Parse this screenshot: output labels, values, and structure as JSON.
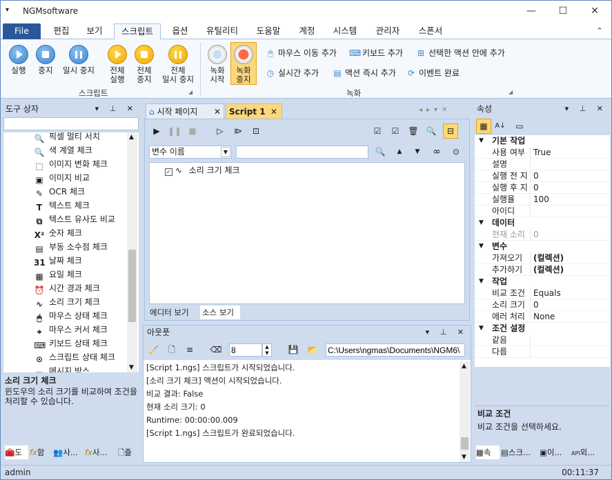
{
  "app": {
    "title": "NGMsoftware",
    "sys_icon": "▾",
    "minimize": "—",
    "maximize": "☐",
    "close": "✕"
  },
  "menu": {
    "file": "File",
    "tabs": [
      "편집",
      "보기",
      "스크립트",
      "옵션",
      "유틸리티",
      "도움말",
      "계정",
      "시스템",
      "관리자",
      "스폰서"
    ],
    "collapse_icon": "chevron-up-icon",
    "collapse": "⌃"
  },
  "ribbon": {
    "script_group": {
      "label": "스크립트",
      "run": "실행",
      "stop": "중지",
      "pause": "일시 중지",
      "run_all": [
        "전체",
        "실행"
      ],
      "stop_all": [
        "전체",
        "중지"
      ],
      "pause_all": [
        "전체",
        "일시 중지"
      ]
    },
    "record_group": {
      "label": "녹화",
      "rec_start": [
        "녹화",
        "시작"
      ],
      "rec_stop": [
        "녹화",
        "중지"
      ],
      "actions": [
        "마우스 이동 추가",
        "키보드 추가",
        "선택한 액션 안에 추가",
        "실시간 추가",
        "액션 즉시 추가",
        "이벤트 완료"
      ]
    }
  },
  "toolbox": {
    "title": "도구 상자",
    "search_value": "",
    "items": [
      {
        "label": "픽셀 멀티 서치",
        "icon": "magnifier-icon",
        "glyph": "🔍"
      },
      {
        "label": "색 계열 체크",
        "icon": "magnifier-icon",
        "glyph": "🔍"
      },
      {
        "label": "이미지 변화 체크",
        "icon": "image-dashed-icon",
        "glyph": "⬚"
      },
      {
        "label": "이미지 비교",
        "icon": "image-icon",
        "glyph": "▣"
      },
      {
        "label": "OCR 체크",
        "icon": "ocr-icon",
        "glyph": "✎"
      },
      {
        "label": "텍스트 체크",
        "icon": "text-t-icon",
        "glyph": "T"
      },
      {
        "label": "텍스트 유사도 비교",
        "icon": "text-compare-icon",
        "glyph": "⧉"
      },
      {
        "label": "숫자 체크",
        "icon": "number-x-icon",
        "glyph": "X²"
      },
      {
        "label": "부동 소수점 체크",
        "icon": "decimal-icon",
        "glyph": "▤"
      },
      {
        "label": "날짜 체크",
        "icon": "calendar-icon",
        "glyph": "31"
      },
      {
        "label": "요일 체크",
        "icon": "calendar-icon",
        "glyph": "▦"
      },
      {
        "label": "시간 경과 체크",
        "icon": "alarm-clock-icon",
        "glyph": "⏰"
      },
      {
        "label": "소리 크기 체크",
        "icon": "waveform-icon",
        "glyph": "∿"
      },
      {
        "label": "마우스 상태 체크",
        "icon": "mouse-icon",
        "glyph": "🖱"
      },
      {
        "label": "마우스 커서 체크",
        "icon": "cursor-icon",
        "glyph": "⌖"
      },
      {
        "label": "키보드 상태 체크",
        "icon": "keyboard-icon",
        "glyph": "⌨"
      },
      {
        "label": "스크립트 상태 체크",
        "icon": "script-status-icon",
        "glyph": "⊙"
      },
      {
        "label": "메시지 박스",
        "icon": "message-icon",
        "glyph": "▬"
      }
    ],
    "desc_title": "소리 크기 체크",
    "desc_text": "윈도우의 소리 크기를 비교하여 조건을 처리할 수 있습니다.",
    "bottom_tabs": [
      "도",
      "함",
      "사...",
      "사...",
      "즐"
    ]
  },
  "editor": {
    "tabs": [
      "시작 페이지",
      "Script 1"
    ],
    "var_select": "변수 이름",
    "var_search": "",
    "tree_item": "소리 크기 체크",
    "view_tabs": [
      "에디터 보기",
      "소스 보기"
    ]
  },
  "output": {
    "title": "아웃풋",
    "font_size": "8",
    "path": "C:\\Users\\ngmas\\Documents\\NGM6\\",
    "lines": [
      "[Script 1.ngs] 스크립트가 시작되었습니다.",
      "[소리 크기 체크] 액션이 시작되었습니다.",
      "비교 결과: False",
      "현재 소리 크기: 0",
      "Runtime: 00:00:00.009",
      "[Script 1.ngs] 스크립트가 완료되었습니다."
    ]
  },
  "properties": {
    "title": "속성",
    "categories": [
      {
        "name": "기본 작업",
        "rows": [
          [
            "사용 여부",
            "True"
          ],
          [
            "설명",
            ""
          ],
          [
            "실행 전 지",
            "0"
          ],
          [
            "실행 후 지",
            "0"
          ],
          [
            "실행율",
            "100"
          ],
          [
            "아이디",
            ""
          ]
        ]
      },
      {
        "name": "데이터",
        "rows": [
          [
            "현재 소리",
            "0"
          ]
        ]
      },
      {
        "name": "변수",
        "rows": [
          [
            "가져오기",
            "(컬렉션)"
          ],
          [
            "추가하기",
            "(컬렉션)"
          ]
        ]
      },
      {
        "name": "작업",
        "rows": [
          [
            "비교 조건",
            "Equals"
          ],
          [
            "소리 크기",
            "0"
          ],
          [
            "에러 처리",
            "None"
          ]
        ]
      },
      {
        "name": "조건 설정",
        "rows": [
          [
            "같음",
            ""
          ],
          [
            "다름",
            ""
          ]
        ]
      }
    ],
    "desc_title": "비교 조건",
    "desc_text": "비교 조건을 선택하세요.",
    "bottom_tabs": [
      "속",
      "스크...",
      "이...",
      "외..."
    ]
  },
  "status": {
    "user": "admin",
    "time": "00:11:37"
  }
}
